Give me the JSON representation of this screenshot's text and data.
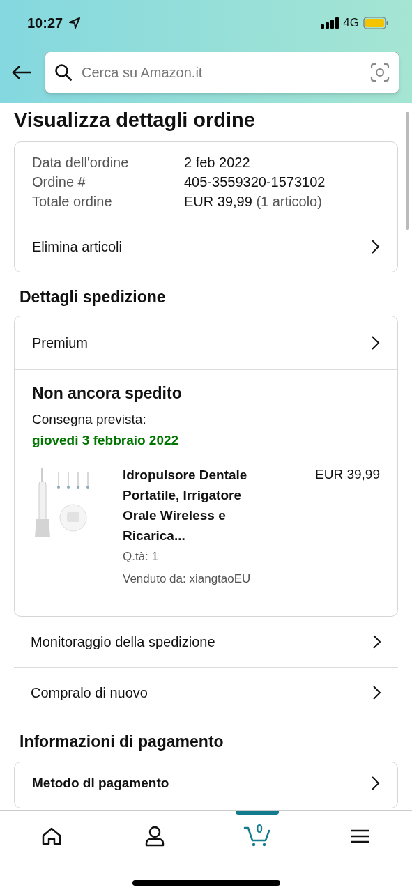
{
  "status_bar": {
    "time": "10:27",
    "network": "4G"
  },
  "search": {
    "placeholder": "Cerca su Amazon.it"
  },
  "title": "Visualizza dettagli ordine",
  "order_summary": {
    "rows": [
      {
        "label": "Data dell'ordine",
        "value": "2 feb 2022"
      },
      {
        "label": "Ordine #",
        "value": "405-3559320-1573102"
      },
      {
        "label": "Totale ordine",
        "value": "EUR 39,99",
        "note": "(1 articolo)"
      }
    ],
    "action": "Elimina articoli"
  },
  "shipping": {
    "heading": "Dettagli spedizione",
    "service": "Premium",
    "status": "Non ancora spedito",
    "delivery_label": "Consegna prevista:",
    "delivery_date": "giovedì 3 febbraio 2022",
    "item": {
      "name": "Idropulsore Dentale Portatile, Irrigatore Orale Wireless e Ricarica...",
      "price": "EUR 39,99",
      "quantity": "Q.tà: 1",
      "seller": "Venduto da: xiangtaoEU"
    },
    "actions": [
      "Monitoraggio della spedizione",
      "Compralo di nuovo"
    ]
  },
  "payment": {
    "heading": "Informazioni di pagamento",
    "method_title": "Metodo di pagamento"
  },
  "bottom_nav": [
    {
      "kind": "home",
      "selected": false
    },
    {
      "kind": "account",
      "selected": false
    },
    {
      "kind": "cart",
      "selected": true,
      "count": "0"
    },
    {
      "kind": "menu",
      "selected": false
    }
  ]
}
